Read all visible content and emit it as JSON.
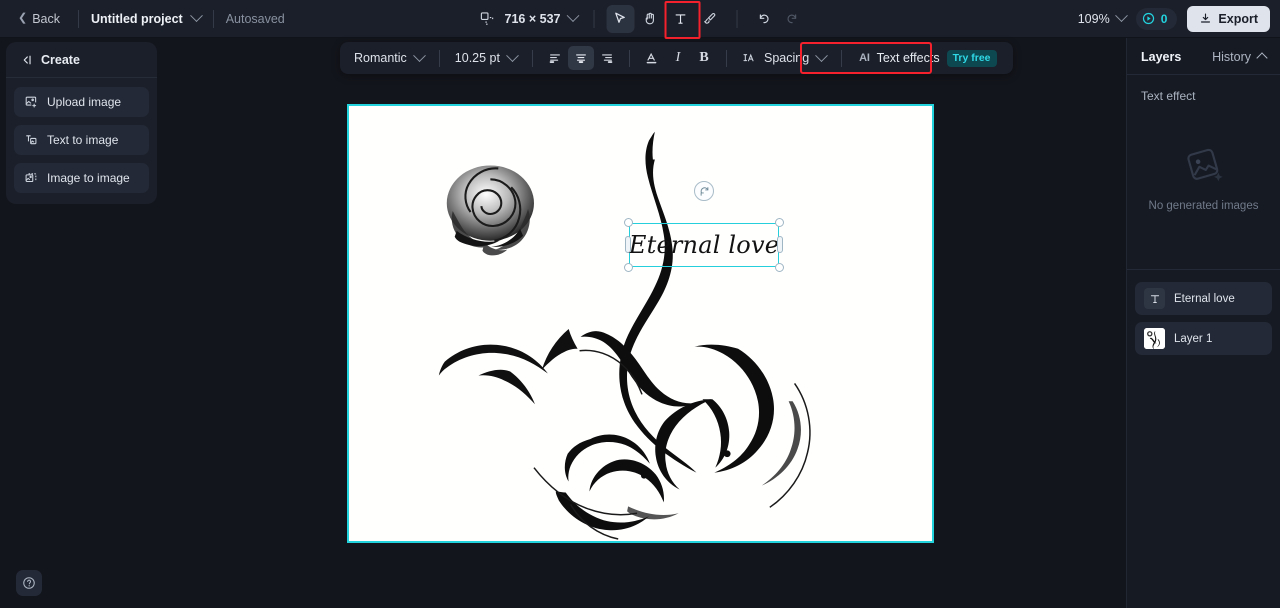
{
  "topbar": {
    "back_label": "Back",
    "project_name": "Untitled project",
    "autosaved_label": "Autosaved",
    "canvas_size": "716 × 537",
    "zoom_level": "109%",
    "credits_count": "0",
    "export_label": "Export",
    "tools": [
      {
        "name": "select-tool",
        "glyph": "cursor",
        "active": true
      },
      {
        "name": "hand-tool",
        "glyph": "hand",
        "active": false
      },
      {
        "name": "text-tool",
        "glyph": "T",
        "active": false,
        "highlighted": true
      },
      {
        "name": "brush-tool",
        "glyph": "brush",
        "active": false
      },
      {
        "name": "undo-tool",
        "glyph": "undo",
        "active": false
      },
      {
        "name": "redo-tool",
        "glyph": "redo",
        "active": false,
        "disabled": true
      }
    ]
  },
  "text_toolbar": {
    "font_family": "Romantic",
    "font_size": "10.25 pt",
    "align_left": "align-left",
    "align_center": "align-center",
    "align_right": "align-right",
    "color_label": "A",
    "italic_label": "I",
    "bold_label": "B",
    "spacing_label": "Spacing",
    "ai_mark": "AI",
    "ai_text_effects_label": "Text effects",
    "try_free_badge": "Try free"
  },
  "left_panel": {
    "header": "Create",
    "items": [
      {
        "label": "Upload image",
        "icon": "upload-image-icon"
      },
      {
        "label": "Text to image",
        "icon": "text-to-image-icon"
      },
      {
        "label": "Image to image",
        "icon": "image-to-image-icon"
      }
    ]
  },
  "right_panel": {
    "tab_layers": "Layers",
    "tab_history": "History",
    "section_title": "Text effect",
    "empty_state_text": "No generated images",
    "layers": [
      {
        "name": "Eternal love",
        "type": "text"
      },
      {
        "name": "Layer 1",
        "type": "image"
      }
    ]
  },
  "canvas": {
    "text_element": "Eternal love",
    "artwork_description": "black-and-white rose and tribal swirl tattoo design"
  },
  "colors": {
    "accent_cyan": "#22d3dd",
    "highlight_red": "#f5222d",
    "panel_bg": "#1b1f29",
    "app_bg": "#13151c",
    "export_bg": "#dfe4ec"
  },
  "help": {
    "label": "?"
  }
}
